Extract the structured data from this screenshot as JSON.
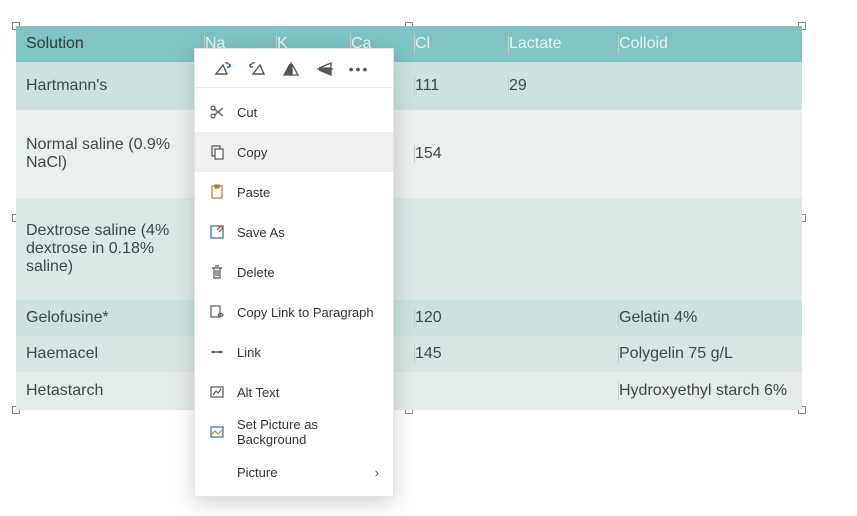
{
  "table": {
    "headers": [
      "Solution",
      "Na",
      "K",
      "Ca",
      "Cl",
      "Lactate",
      "Colloid"
    ],
    "rows": [
      {
        "solution": "Hartmann's",
        "na": "",
        "k": "",
        "ca": "",
        "cl": "111",
        "lactate": "29",
        "colloid": ""
      },
      {
        "solution": "Normal saline (0.9% NaCl)",
        "na": "",
        "k": "",
        "ca": "",
        "cl": "154",
        "lactate": "",
        "colloid": ""
      },
      {
        "solution": "Dextrose saline (4% dextrose in 0.18% saline)",
        "na": "",
        "k": "",
        "ca": "",
        "cl": "",
        "lactate": "",
        "colloid": ""
      },
      {
        "solution": "Gelofusine*",
        "na": "",
        "k": "",
        "ca": "",
        "cl": "120",
        "lactate": "",
        "colloid": "Gelatin 4%"
      },
      {
        "solution": "Haemacel",
        "na": "",
        "k": "",
        "ca": "",
        "cl": "145",
        "lactate": "",
        "colloid": "Polygelin 75 g/L"
      },
      {
        "solution": "Hetastarch",
        "na": "",
        "k": "",
        "ca": "",
        "cl": "",
        "lactate": "",
        "colloid": "Hydroxyethyl starch 6%"
      }
    ]
  },
  "menu": {
    "cut": "Cut",
    "copy": "Copy",
    "paste": "Paste",
    "saveAs": "Save As",
    "delete": "Delete",
    "copyLinkParagraph": "Copy Link to Paragraph",
    "link": "Link",
    "altText": "Alt Text",
    "setBackground": "Set Picture as Background",
    "picture": "Picture"
  }
}
